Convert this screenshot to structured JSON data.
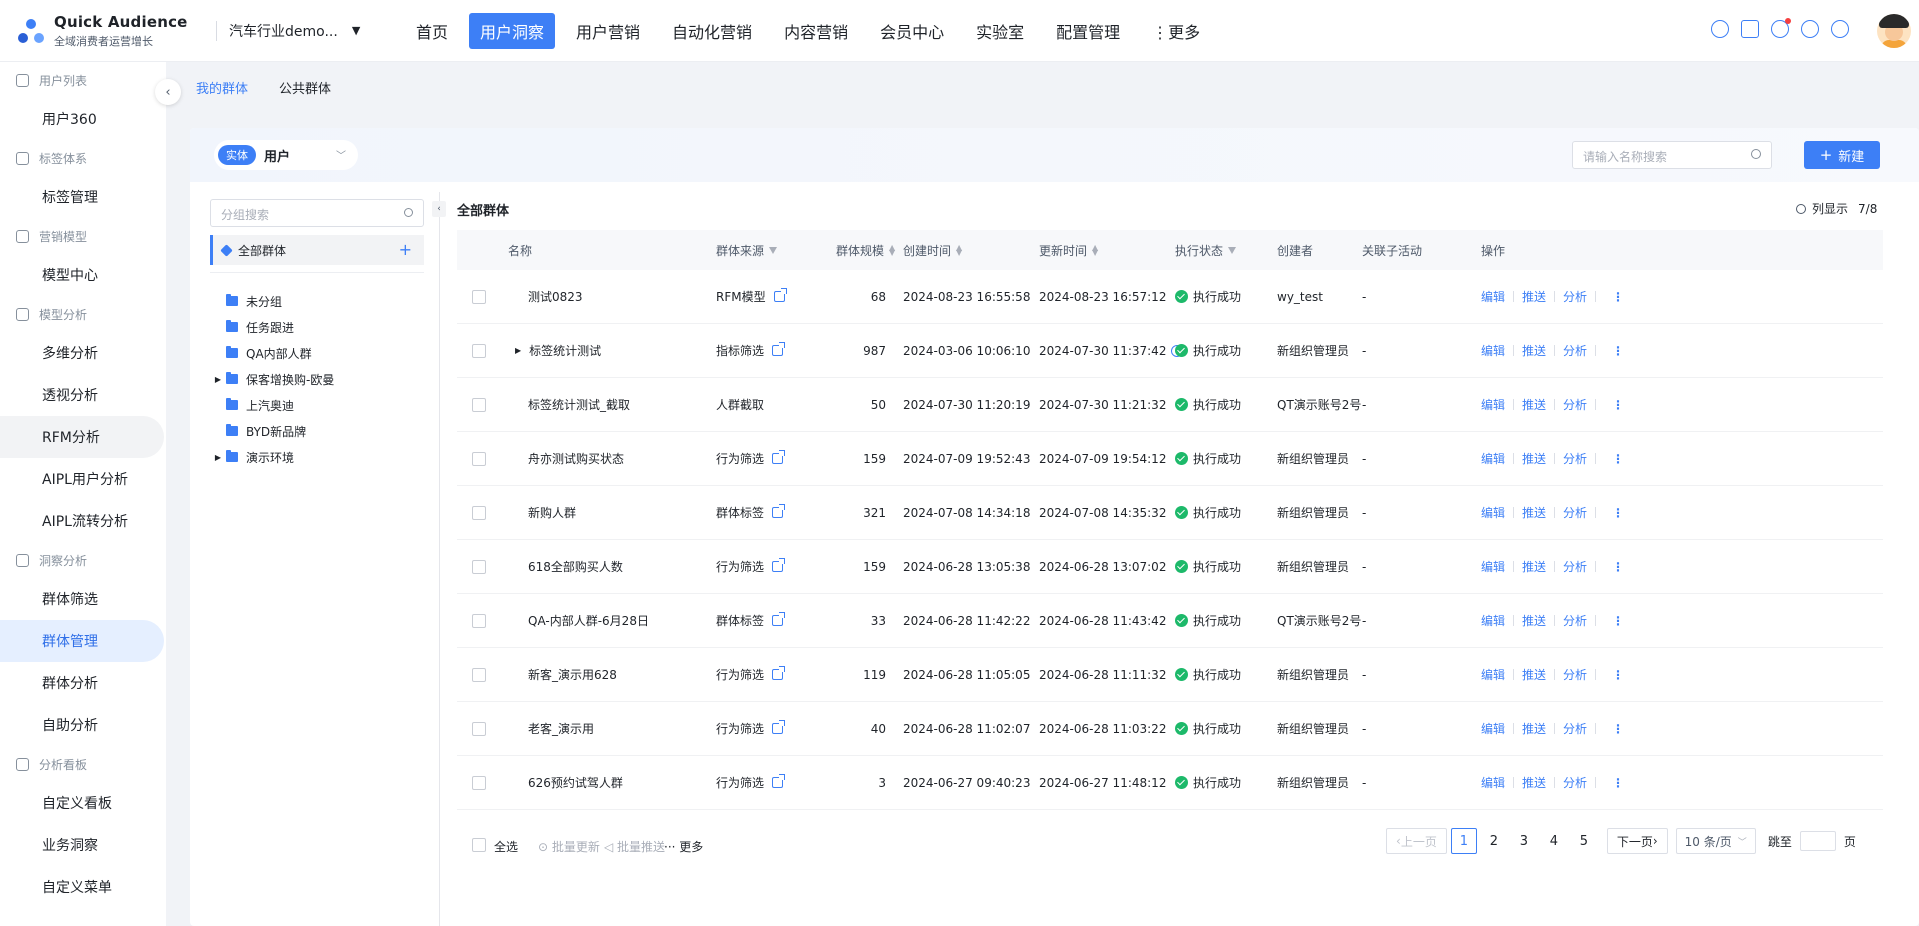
{
  "app": {
    "name": "Quick Audience",
    "tagline": "全域消费者运营增长"
  },
  "org": {
    "name": "汽车行业demo..."
  },
  "nav": [
    "首页",
    "用户洞察",
    "用户营销",
    "自动化营销",
    "内容营销",
    "会员中心",
    "实验室",
    "配置管理",
    "更多"
  ],
  "nav_more_glyph": "⋮",
  "accent_color": "#3d7ff6",
  "top_icons": [
    "help-circle-icon",
    "briefcase-icon",
    "bell-icon",
    "question-icon",
    "globe-icon"
  ],
  "sidebar": [
    {
      "group": "用户列表",
      "icon": "layers-icon",
      "items": [
        "用户360"
      ]
    },
    {
      "group": "标签体系",
      "icon": "tag-icon",
      "items": [
        "标签管理"
      ]
    },
    {
      "group": "营销模型",
      "icon": "send-icon",
      "items": [
        "模型中心"
      ]
    },
    {
      "group": "模型分析",
      "icon": "analysis-icon",
      "items": [
        "多维分析",
        "透视分析",
        "RFM分析",
        "AIPL用户分析",
        "AIPL流转分析"
      ]
    },
    {
      "group": "洞察分析",
      "icon": "users-icon",
      "items": [
        "群体筛选",
        "群体管理",
        "群体分析",
        "自助分析"
      ]
    },
    {
      "group": "分析看板",
      "icon": "pie-icon",
      "items": [
        "自定义看板",
        "业务洞察",
        "自定义菜单"
      ]
    }
  ],
  "sidebar_active": "群体管理",
  "sidebar_hover": "RFM分析",
  "subtabs": [
    "我的群体",
    "公共群体"
  ],
  "entity": {
    "badge": "实体",
    "value": "用户"
  },
  "search_placeholder": "请输入名称搜索",
  "new_button": "新建",
  "group_search_placeholder": "分组搜索",
  "group_all": "全部群体",
  "groups": [
    {
      "name": "未分组",
      "expandable": false
    },
    {
      "name": "任务跟进",
      "expandable": false
    },
    {
      "name": "QA内部人群",
      "expandable": false
    },
    {
      "name": "保客增换购-欧曼",
      "expandable": true
    },
    {
      "name": "上汽奥迪",
      "expandable": false
    },
    {
      "name": "BYD新品牌",
      "expandable": false
    },
    {
      "name": "演示环境",
      "expandable": true
    }
  ],
  "table_title": "全部群体",
  "col_show": {
    "label": "列显示",
    "count": "7/8"
  },
  "columns": [
    "名称",
    "群体来源",
    "群体规模",
    "创建时间",
    "更新时间",
    "执行状态",
    "创建者",
    "关联子活动",
    "操作"
  ],
  "rows": [
    {
      "name": "测试0823",
      "source": "RFM模型",
      "source_link": true,
      "size": "68",
      "created": "2024-08-23 16:55:58",
      "updated": "2024-08-23 16:57:12",
      "updated_clock": false,
      "status": "执行成功",
      "creator": "wy_test",
      "activity": "-",
      "expandable": false
    },
    {
      "name": "标签统计测试",
      "source": "指标筛选",
      "source_link": true,
      "size": "987",
      "created": "2024-03-06 10:06:10",
      "updated": "2024-07-30 11:37:42",
      "updated_clock": true,
      "status": "执行成功",
      "creator": "新组织管理员",
      "activity": "-",
      "expandable": true
    },
    {
      "name": "标签统计测试_截取",
      "source": "人群截取",
      "source_link": false,
      "size": "50",
      "created": "2024-07-30 11:20:19",
      "updated": "2024-07-30 11:21:32",
      "updated_clock": false,
      "status": "执行成功",
      "creator": "QT演示账号2号",
      "activity": "-",
      "expandable": false
    },
    {
      "name": "舟亦测试购买状态",
      "source": "行为筛选",
      "source_link": true,
      "size": "159",
      "created": "2024-07-09 19:52:43",
      "updated": "2024-07-09 19:54:12",
      "updated_clock": false,
      "status": "执行成功",
      "creator": "新组织管理员",
      "activity": "-",
      "expandable": false
    },
    {
      "name": "新购人群",
      "source": "群体标签",
      "source_link": true,
      "size": "321",
      "created": "2024-07-08 14:34:18",
      "updated": "2024-07-08 14:35:32",
      "updated_clock": false,
      "status": "执行成功",
      "creator": "新组织管理员",
      "activity": "-",
      "expandable": false
    },
    {
      "name": "618全部购买人数",
      "source": "行为筛选",
      "source_link": true,
      "size": "159",
      "created": "2024-06-28 13:05:38",
      "updated": "2024-06-28 13:07:02",
      "updated_clock": false,
      "status": "执行成功",
      "creator": "新组织管理员",
      "activity": "-",
      "expandable": false
    },
    {
      "name": "QA-内部人群-6月28日",
      "source": "群体标签",
      "source_link": true,
      "size": "33",
      "created": "2024-06-28 11:42:22",
      "updated": "2024-06-28 11:43:42",
      "updated_clock": false,
      "status": "执行成功",
      "creator": "QT演示账号2号",
      "activity": "-",
      "expandable": false
    },
    {
      "name": "新客_演示用628",
      "source": "行为筛选",
      "source_link": true,
      "size": "119",
      "created": "2024-06-28 11:05:05",
      "updated": "2024-06-28 11:11:32",
      "updated_clock": false,
      "status": "执行成功",
      "creator": "新组织管理员",
      "activity": "-",
      "expandable": false
    },
    {
      "name": "老客_演示用",
      "source": "行为筛选",
      "source_link": true,
      "size": "40",
      "created": "2024-06-28 11:02:07",
      "updated": "2024-06-28 11:03:22",
      "updated_clock": false,
      "status": "执行成功",
      "creator": "新组织管理员",
      "activity": "-",
      "expandable": false
    },
    {
      "name": "626预约试驾人群",
      "source": "行为筛选",
      "source_link": true,
      "size": "3",
      "created": "2024-06-27 09:40:23",
      "updated": "2024-06-27 11:48:12",
      "updated_clock": false,
      "status": "执行成功",
      "creator": "新组织管理员",
      "activity": "-",
      "expandable": false
    }
  ],
  "row_actions": [
    "编辑",
    "推送",
    "分析"
  ],
  "footer": {
    "select_all": "全选",
    "batch_update": "批量更新",
    "batch_push": "批量推送",
    "more": "··· 更多"
  },
  "pagination": {
    "prev": "上一页",
    "pages": [
      "1",
      "2",
      "3",
      "4",
      "5"
    ],
    "current": "1",
    "next": "下一页",
    "page_size": "10 条/页",
    "jump_label": "跳至",
    "page_suffix": "页"
  }
}
